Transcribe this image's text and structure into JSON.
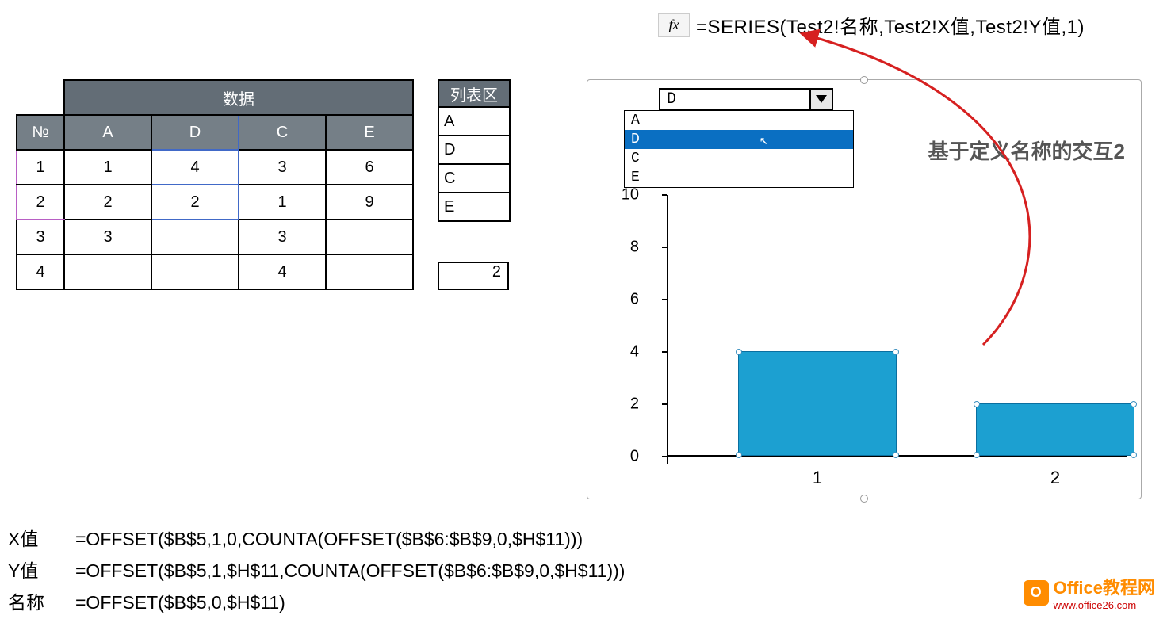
{
  "formulaBar": {
    "fx": "fx",
    "formula": "=SERIES(Test2!名称,Test2!X值,Test2!Y值,1)"
  },
  "dataTable": {
    "mergeHeader": "数据",
    "headers": {
      "no": "№",
      "a": "A",
      "d": "D",
      "c": "C",
      "e": "E"
    },
    "rows": [
      {
        "no": "1",
        "a": "1",
        "d": "4",
        "c": "3",
        "e": "6"
      },
      {
        "no": "2",
        "a": "2",
        "d": "2",
        "c": "1",
        "e": "9"
      },
      {
        "no": "3",
        "a": "3",
        "d": "",
        "c": "3",
        "e": ""
      },
      {
        "no": "4",
        "a": "",
        "d": "",
        "c": "4",
        "e": ""
      }
    ]
  },
  "listTable": {
    "header": "列表区",
    "items": [
      "A",
      "D",
      "C",
      "E"
    ]
  },
  "singleValue": "2",
  "combo": {
    "value": "D",
    "options": [
      "A",
      "D",
      "C",
      "E"
    ],
    "selectedIndex": 1
  },
  "chart_data": {
    "type": "bar",
    "title": "基于定义名称的交互2",
    "categories": [
      "1",
      "2"
    ],
    "values": [
      4,
      2
    ],
    "ylim": [
      0,
      10
    ],
    "yticks": [
      0,
      2,
      4,
      6,
      8,
      10
    ],
    "xlabel": "",
    "ylabel": ""
  },
  "definitions": {
    "xVal": {
      "label": "X值",
      "formula": "=OFFSET($B$5,1,0,COUNTA(OFFSET($B$6:$B$9,0,$H$11)))"
    },
    "yVal": {
      "label": "Y值",
      "formula": "=OFFSET($B$5,1,$H$11,COUNTA(OFFSET($B$6:$B$9,0,$H$11)))"
    },
    "name": {
      "label": "名称",
      "formula": "=OFFSET($B$5,0,$H$11)"
    }
  },
  "logo": {
    "icon": "O",
    "line1": "Office教程网",
    "line2": "www.office26.com"
  }
}
